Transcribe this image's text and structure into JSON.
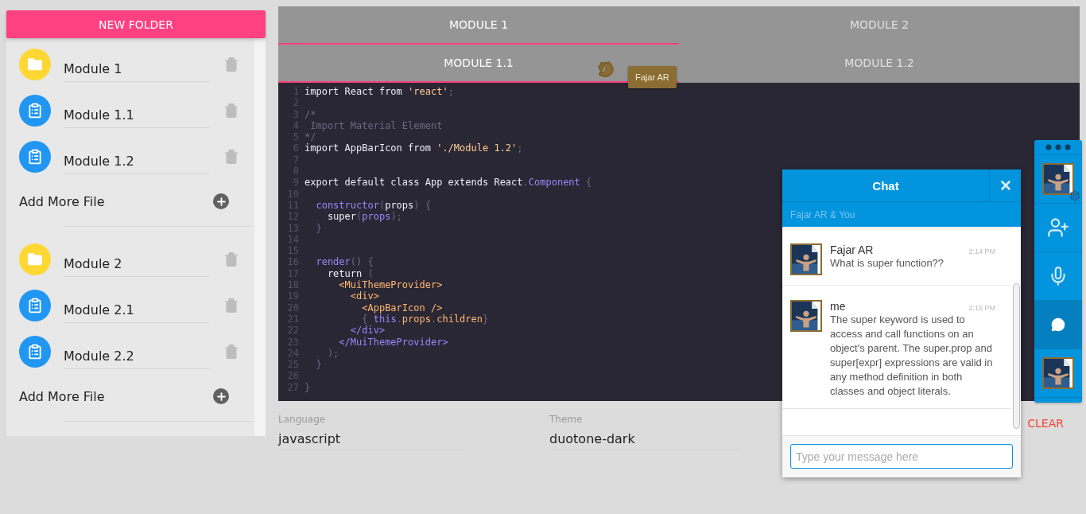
{
  "sidebar": {
    "new_folder_button": "NEW FOLDER",
    "folders": [
      {
        "name": "Module 1",
        "files": [
          {
            "name": "Module 1.1"
          },
          {
            "name": "Module 1.2"
          }
        ],
        "add_label": "Add More File"
      },
      {
        "name": "Module 2",
        "files": [
          {
            "name": "Module 2.1"
          },
          {
            "name": "Module 2.2"
          }
        ],
        "add_label": "Add More File"
      }
    ]
  },
  "tabs": [
    {
      "label": "MODULE 1",
      "selected": true
    },
    {
      "label": "MODULE 2",
      "selected": false
    }
  ],
  "subtabs": [
    {
      "label": "MODULE 1.1",
      "selected": true
    },
    {
      "label": "MODULE 1.2",
      "selected": false
    }
  ],
  "tooltip": "Fajar AR",
  "editor": {
    "lines": [
      {
        "number": "1",
        "tokens": [
          {
            "t": "import React from ",
            "kind": "plain"
          },
          {
            "t": "'react'",
            "kind": "string"
          },
          {
            "t": ";",
            "kind": "punct"
          }
        ]
      },
      {
        "number": "2"
      },
      {
        "number": "3",
        "tokens": [
          {
            "t": "/*",
            "kind": "comment"
          }
        ]
      },
      {
        "number": "4",
        "tokens": [
          {
            "t": " Import Material Element",
            "kind": "comment"
          }
        ]
      },
      {
        "number": "5",
        "tokens": [
          {
            "t": "*/",
            "kind": "comment"
          }
        ]
      },
      {
        "number": "6",
        "tokens": [
          {
            "t": "import AppBarIcon from ",
            "kind": "plain"
          },
          {
            "t": "'./Module 1.2'",
            "kind": "string"
          },
          {
            "t": ";",
            "kind": "punct"
          }
        ]
      },
      {
        "number": "7"
      },
      {
        "number": "8"
      },
      {
        "number": "9",
        "tokens": [
          {
            "t": "export default class App extends React",
            "kind": "plain"
          },
          {
            "t": ".",
            "kind": "punct"
          },
          {
            "t": "Component",
            "kind": "purple"
          },
          {
            "t": " {",
            "kind": "punct"
          }
        ]
      },
      {
        "number": "10"
      },
      {
        "number": "11",
        "tokens": [
          {
            "t": "  constructor",
            "kind": "purple"
          },
          {
            "t": "(",
            "kind": "punct"
          },
          {
            "t": "props",
            "kind": "plain"
          },
          {
            "t": ") {",
            "kind": "punct"
          }
        ]
      },
      {
        "number": "12",
        "tokens": [
          {
            "t": "    super",
            "kind": "plain"
          },
          {
            "t": "(",
            "kind": "punct"
          },
          {
            "t": "props",
            "kind": "purple"
          },
          {
            "t": ");",
            "kind": "punct"
          }
        ]
      },
      {
        "number": "13",
        "tokens": [
          {
            "t": "  }",
            "kind": "punct"
          }
        ]
      },
      {
        "number": "14"
      },
      {
        "number": "15"
      },
      {
        "number": "16",
        "tokens": [
          {
            "t": "  render",
            "kind": "purple"
          },
          {
            "t": "() {",
            "kind": "punct"
          }
        ]
      },
      {
        "number": "17",
        "tokens": [
          {
            "t": "    return",
            "kind": "plain"
          },
          {
            "t": " (",
            "kind": "punct"
          }
        ]
      },
      {
        "number": "18",
        "tokens": [
          {
            "t": "      <MuiThemeProvider>",
            "kind": "orange"
          }
        ]
      },
      {
        "number": "19",
        "tokens": [
          {
            "t": "        <div>",
            "kind": "orange"
          }
        ]
      },
      {
        "number": "20",
        "tokens": [
          {
            "t": "          <AppBarIcon />",
            "kind": "orange"
          }
        ]
      },
      {
        "number": "21",
        "tokens": [
          {
            "t": "          { ",
            "kind": "punct"
          },
          {
            "t": "this",
            "kind": "purple"
          },
          {
            "t": ".",
            "kind": "punct"
          },
          {
            "t": "props",
            "kind": "orange"
          },
          {
            "t": ".",
            "kind": "punct"
          },
          {
            "t": "children",
            "kind": "orange"
          },
          {
            "t": "}",
            "kind": "punct"
          }
        ]
      },
      {
        "number": "22",
        "tokens": [
          {
            "t": "        </div>",
            "kind": "purple"
          }
        ]
      },
      {
        "number": "23",
        "tokens": [
          {
            "t": "      </MuiThemeProvider>",
            "kind": "purple"
          }
        ]
      },
      {
        "number": "24",
        "tokens": [
          {
            "t": "    );",
            "kind": "punct"
          }
        ]
      },
      {
        "number": "25",
        "tokens": [
          {
            "t": "  }",
            "kind": "punct"
          }
        ]
      },
      {
        "number": "26"
      },
      {
        "number": "27",
        "tokens": [
          {
            "t": "}",
            "kind": "punct"
          }
        ]
      }
    ]
  },
  "settings": [
    {
      "label": "Language",
      "value": "javascript"
    },
    {
      "label": "Theme",
      "value": "duotone-dark"
    }
  ],
  "clear_button": "CLEAR",
  "chat": {
    "title": "Chat",
    "subtitle": "Fajar AR & You",
    "messages": [
      {
        "author": "Fajar AR",
        "time": "2:14 PM",
        "text": "What is super function??"
      },
      {
        "author": "me",
        "time": "2:15 PM",
        "text": "The super keyword is used to access and call functions on an object's parent. The super.prop and super[expr] expressions are valid in any method definition in both classes and object literals."
      }
    ],
    "input_placeholder": "Type your message here"
  },
  "dock": {
    "items": [
      {
        "kind": "avatar-settings",
        "selected": false
      },
      {
        "kind": "add-user",
        "selected": false
      },
      {
        "kind": "mic",
        "selected": false
      },
      {
        "kind": "chat",
        "selected": true
      },
      {
        "kind": "avatar",
        "selected": false
      }
    ]
  }
}
